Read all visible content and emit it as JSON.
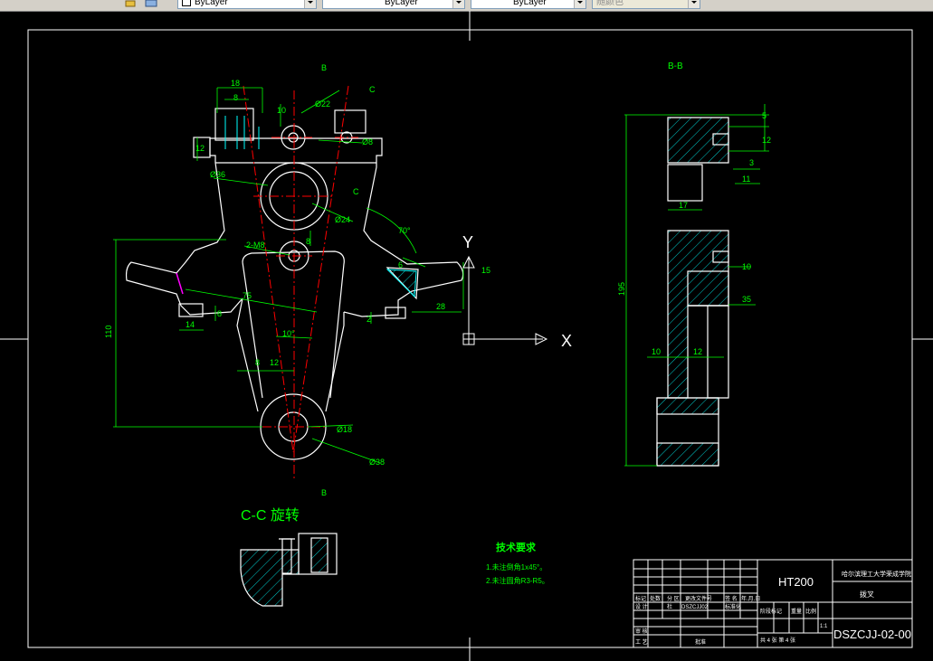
{
  "toolbar": {
    "layer_dropdown": "ByLayer",
    "linetype_dropdown": "ByLayer",
    "lineweight_dropdown": "ByLayer",
    "plotstyle_dropdown": "随颜色"
  },
  "drawing": {
    "section_bb_label": "B-B",
    "section_b_top": "B",
    "section_b_bottom": "B",
    "section_c_label": "C",
    "section_c_label2": "C",
    "cc_view_title": "C-C 旋转",
    "tech_req_title": "技术要求",
    "tech_req_1": "1.未注倒角1x45°。",
    "tech_req_2": "2.未注圆角R3-R5。",
    "ucs_x": "X",
    "ucs_y": "Y",
    "dims_main": {
      "d18": "18",
      "d8": "8",
      "d10": "10",
      "d22": "Ø22",
      "d8b": "Ø8",
      "d12": "12",
      "d36": "Ø36",
      "d24": "Ø24",
      "a70": "70°",
      "d8c": "8",
      "m8": "2-M8",
      "d6": "6",
      "d15": "15",
      "d75": "75",
      "d28": "28",
      "d2": "2",
      "d110": "110",
      "d14": "14",
      "d8d": "8",
      "a10": "10°",
      "d8e": "8",
      "d12b": "12",
      "d18b": "Ø18",
      "d38": "Ø38"
    },
    "dims_side": {
      "d5": "5",
      "d12": "12",
      "d3": "3",
      "d11": "11",
      "d17": "17",
      "d10": "10",
      "d35": "35",
      "d195": "195",
      "d10b": "10",
      "d12b": "12"
    }
  },
  "title_block": {
    "material": "HT200",
    "university": "哈尔滨理工大学荣成学院",
    "part_name": "拨叉",
    "drawing_no": "DSZCJJ-02-00",
    "scale": "1:1",
    "sheet_info": "共 4 张  第 4 张",
    "row_labels": [
      "标记",
      "处数",
      "分 区",
      "更改文件号",
      "签 名",
      "年.月.日"
    ],
    "row2_labels": [
      "设 计",
      "杜",
      "DSZCJJ02",
      "标准化"
    ],
    "row3_labels": [
      "审 核"
    ],
    "row4_labels": [
      "工 艺",
      "批准"
    ],
    "stage_labels": [
      "阶段标记",
      "重量",
      "比例"
    ]
  },
  "colors": {
    "background": "#000000",
    "white": "#ffffff",
    "green": "#00ff00",
    "red": "#ff0000",
    "cyan": "#00ffff",
    "yellow": "#ffff00",
    "magenta": "#ff00ff"
  }
}
